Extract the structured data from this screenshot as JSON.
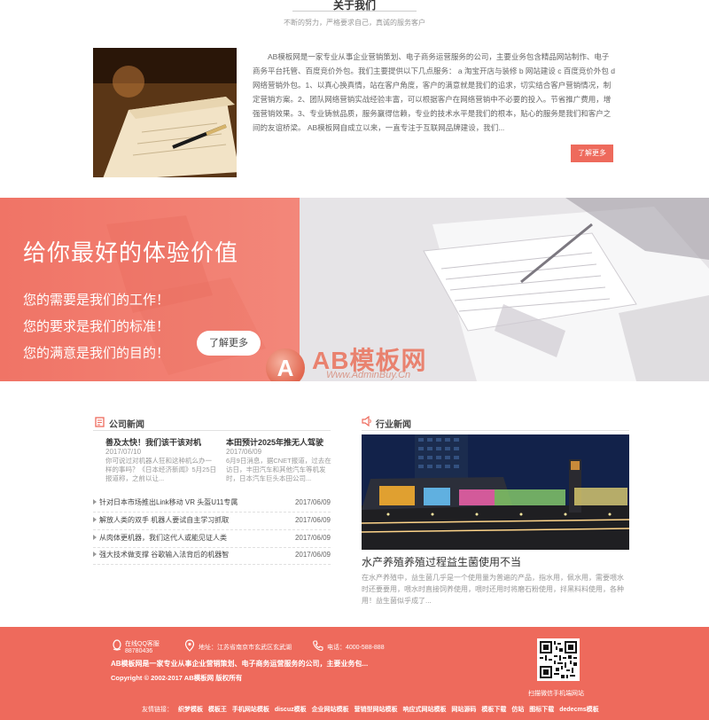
{
  "about": {
    "title": "关于我们",
    "subtitle": "不断的努力，严格要求自己，真诚的服务客户",
    "text": "AB模板网是一家专业从事企业营销策划、电子商务运营服务的公司，主要业务包含精品网站制作、电子商务平台托管、百度竞价外包。我们主要提供以下几点服务： a 淘宝开店与装修 b 网站建设 c 百度竞价外包 d 网络营销外包。1、以真心换真情，站在客户角度，客户的满意就是我们的追求，切实结合客户营销情况，制定营销方案。2、团队网络营销实战经验丰富，可以根据客户在网络营销中不必要的投入。节省推广费用，增强营销效果。3、专业铸就品质，服务赢得信赖，专业的技术水平是我们的根本，贴心的服务是我们和客户之间的友谊桥梁。 AB模板网自成立以来，一直专注于互联网品牌建设，我们...",
    "more_label": "了解更多"
  },
  "banner": {
    "title": "给你最好的体验价值",
    "lines": [
      "您的需要是我们的工作！",
      "您的要求是我们的标准！",
      "您的满意是我们的目的！"
    ],
    "button_label": "了解更多",
    "watermark_name": "AB模板网",
    "watermark_url": "Www.AdminBuy.Cn",
    "watermark_logo": "A"
  },
  "company_news": {
    "title": "公司新闻",
    "top": [
      {
        "title": "善及太快！我们该干该对机",
        "date": "2017/07/10",
        "body": "你可说过对机器人狂和这种机么办一样的事吗？《日本经济新闻》5月25日报道称，之前以让..."
      },
      {
        "title": "本田预计2025年推无人驾驶",
        "date": "2017/06/09",
        "body": "6月9日消息，据CNET报道，过去在访日，丰田汽车和其他汽车等机发时，日本汽车巨头本田公司..."
      }
    ],
    "items": [
      {
        "title": "针对日本市场推出Link移动 VR 头盔U11专属",
        "date": "2017/06/09"
      },
      {
        "title": "解放人类的双手 机器人要试自主学习抓取",
        "date": "2017/06/09"
      },
      {
        "title": "从肉体更机器，我们这代人或能见证人类",
        "date": "2017/06/09"
      },
      {
        "title": "强大技术做支撑 谷歌输入法背后的机器智",
        "date": "2017/06/09"
      }
    ]
  },
  "industry_news": {
    "title": "行业新闻",
    "headline": "水产养殖养殖过程益生菌使用不当",
    "body": "在水产养殖中，益生菌几乎是一个使用量为普遍的产品，指水用，佩水用，需要喂水时还要要用，喂水时直接饲养使用，喂时还用时将磨石粉使用，拌黑料料使用，各种用！益生菌似乎成了..."
  },
  "footer": {
    "qq_label": "在线QQ客服",
    "qq_number": "88780436",
    "address_label": "地址：江苏省南京市玄武区玄武湖",
    "phone_label": "电话：4000-588-888",
    "description": "AB模板网是一家专业从事企业营销策划、电子商务运营服务的公司，主要业务包...",
    "copyright": "Copyright © 2002-2017 AB模板网 版权所有",
    "qr_label": "扫描微信手机端网站",
    "links_label": "友情链接：",
    "links": [
      "织梦模板",
      "模板王",
      "手机网站模板",
      "discuz模板",
      "企业网站模板",
      "营销型网站模板",
      "响应式网站模板",
      "网站源码",
      "模板下载",
      "仿站",
      "图标下载",
      "dedecms模板"
    ]
  },
  "colors": {
    "accent": "#ee6a5c",
    "banner_left": "#f07466"
  }
}
